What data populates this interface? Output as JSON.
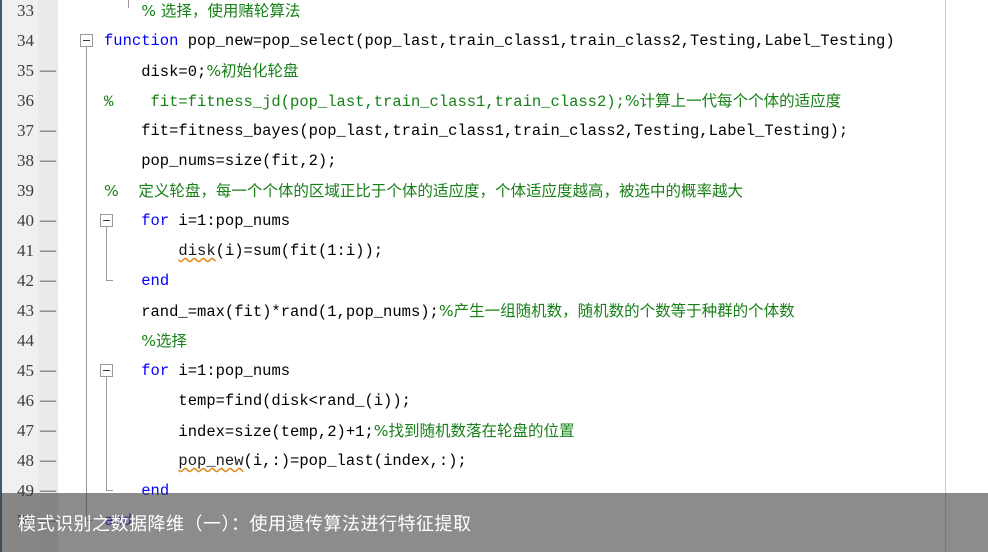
{
  "editor": {
    "language": "MATLAB",
    "colors": {
      "keyword": "#0000ff",
      "comment": "#178117",
      "text": "#000000",
      "gutter_bg": "#f0f0f0",
      "breakpoint_bg": "#eaeaea",
      "panel_edge": "#3c5a78",
      "column_guide": "#c9c9c9",
      "warning_squiggle": "#e08a1a",
      "overlay_bg": "rgba(70,70,70,0.62)",
      "overlay_text": "#ffffff"
    },
    "first_visible_line": 33,
    "last_visible_line": 50,
    "lines": [
      {
        "number": "33",
        "breakpoint": "",
        "fold": "none",
        "tokens": [
          {
            "t": "    ",
            "c": "txt"
          },
          {
            "t": "% 选择，使用赌轮算法",
            "c": "cm-cjk"
          }
        ]
      },
      {
        "number": "34",
        "breakpoint": "",
        "fold": "open-start",
        "tokens": [
          {
            "t": "function",
            "c": "kw"
          },
          {
            "t": " pop_new=pop_select(pop_last,train_class1,train_class2,Testing,Label_Testing)",
            "c": "txt"
          }
        ]
      },
      {
        "number": "35",
        "breakpoint": "—",
        "fold": "line",
        "tokens": [
          {
            "t": "    disk=0;",
            "c": "txt"
          },
          {
            "t": "%初始化轮盘",
            "c": "cm-cjk"
          }
        ]
      },
      {
        "number": "36",
        "breakpoint": "",
        "fold": "line",
        "tokens": [
          {
            "t": "%    fit=fitness_jd(pop_last,train_class1,train_class2);",
            "c": "cm"
          },
          {
            "t": "%计算上一代每个个体的适应度",
            "c": "cm-cjk"
          }
        ]
      },
      {
        "number": "37",
        "breakpoint": "—",
        "fold": "line",
        "tokens": [
          {
            "t": "    fit=fitness_bayes(pop_last,train_class1,train_class2,Testing,Label_Testing);",
            "c": "txt"
          }
        ]
      },
      {
        "number": "38",
        "breakpoint": "—",
        "fold": "line",
        "tokens": [
          {
            "t": "    pop_nums=size(fit,2);",
            "c": "txt"
          }
        ]
      },
      {
        "number": "39",
        "breakpoint": "",
        "fold": "line",
        "tokens": [
          {
            "t": "%    定义轮盘，每一个个体的区域正比于个体的适应度，个体适应度越高，被选中的概率越大",
            "c": "cm-cjk"
          }
        ]
      },
      {
        "number": "40",
        "breakpoint": "—",
        "fold": "open-start-inner",
        "tokens": [
          {
            "t": "    ",
            "c": "txt"
          },
          {
            "t": "for",
            "c": "kw"
          },
          {
            "t": " i=1:pop_nums",
            "c": "txt"
          }
        ]
      },
      {
        "number": "41",
        "breakpoint": "—",
        "fold": "line-inner",
        "tokens": [
          {
            "t": "        ",
            "c": "txt"
          },
          {
            "t": "disk",
            "c": "warn"
          },
          {
            "t": "(i)=sum(fit(1:i));",
            "c": "txt"
          }
        ]
      },
      {
        "number": "42",
        "breakpoint": "—",
        "fold": "end-inner",
        "tokens": [
          {
            "t": "    ",
            "c": "txt"
          },
          {
            "t": "end",
            "c": "kw"
          }
        ]
      },
      {
        "number": "43",
        "breakpoint": "—",
        "fold": "line",
        "tokens": [
          {
            "t": "    rand_=max(fit)*rand(1,pop_nums);",
            "c": "txt"
          },
          {
            "t": "%产生一组随机数，随机数的个数等于种群的个体数",
            "c": "cm-cjk"
          }
        ]
      },
      {
        "number": "44",
        "breakpoint": "",
        "fold": "line",
        "tokens": [
          {
            "t": "    ",
            "c": "txt"
          },
          {
            "t": "%选择",
            "c": "cm-cjk"
          }
        ]
      },
      {
        "number": "45",
        "breakpoint": "—",
        "fold": "open-start-inner",
        "tokens": [
          {
            "t": "    ",
            "c": "txt"
          },
          {
            "t": "for",
            "c": "kw"
          },
          {
            "t": " i=1:pop_nums",
            "c": "txt"
          }
        ]
      },
      {
        "number": "46",
        "breakpoint": "—",
        "fold": "line-inner",
        "tokens": [
          {
            "t": "        temp=find(disk<rand_(i));",
            "c": "txt"
          }
        ]
      },
      {
        "number": "47",
        "breakpoint": "—",
        "fold": "line-inner",
        "tokens": [
          {
            "t": "        index=size(temp,2)+1;",
            "c": "txt"
          },
          {
            "t": "%找到随机数落在轮盘的位置",
            "c": "cm-cjk"
          }
        ]
      },
      {
        "number": "48",
        "breakpoint": "—",
        "fold": "line-inner",
        "tokens": [
          {
            "t": "        ",
            "c": "txt"
          },
          {
            "t": "pop_new",
            "c": "warn"
          },
          {
            "t": "(i,:)=pop_last(index,:);",
            "c": "txt"
          }
        ]
      },
      {
        "number": "49",
        "breakpoint": "—",
        "fold": "end-inner",
        "tokens": [
          {
            "t": "    ",
            "c": "txt"
          },
          {
            "t": "end",
            "c": "kw"
          }
        ]
      },
      {
        "number": "50",
        "breakpoint": "—",
        "fold": "end",
        "tokens": [
          {
            "t": "",
            "c": "txt"
          },
          {
            "t": "end",
            "c": "kw"
          }
        ]
      }
    ]
  },
  "caption": {
    "text": "模式识别之数据降维（一）：使用遗传算法进行特征提取"
  }
}
